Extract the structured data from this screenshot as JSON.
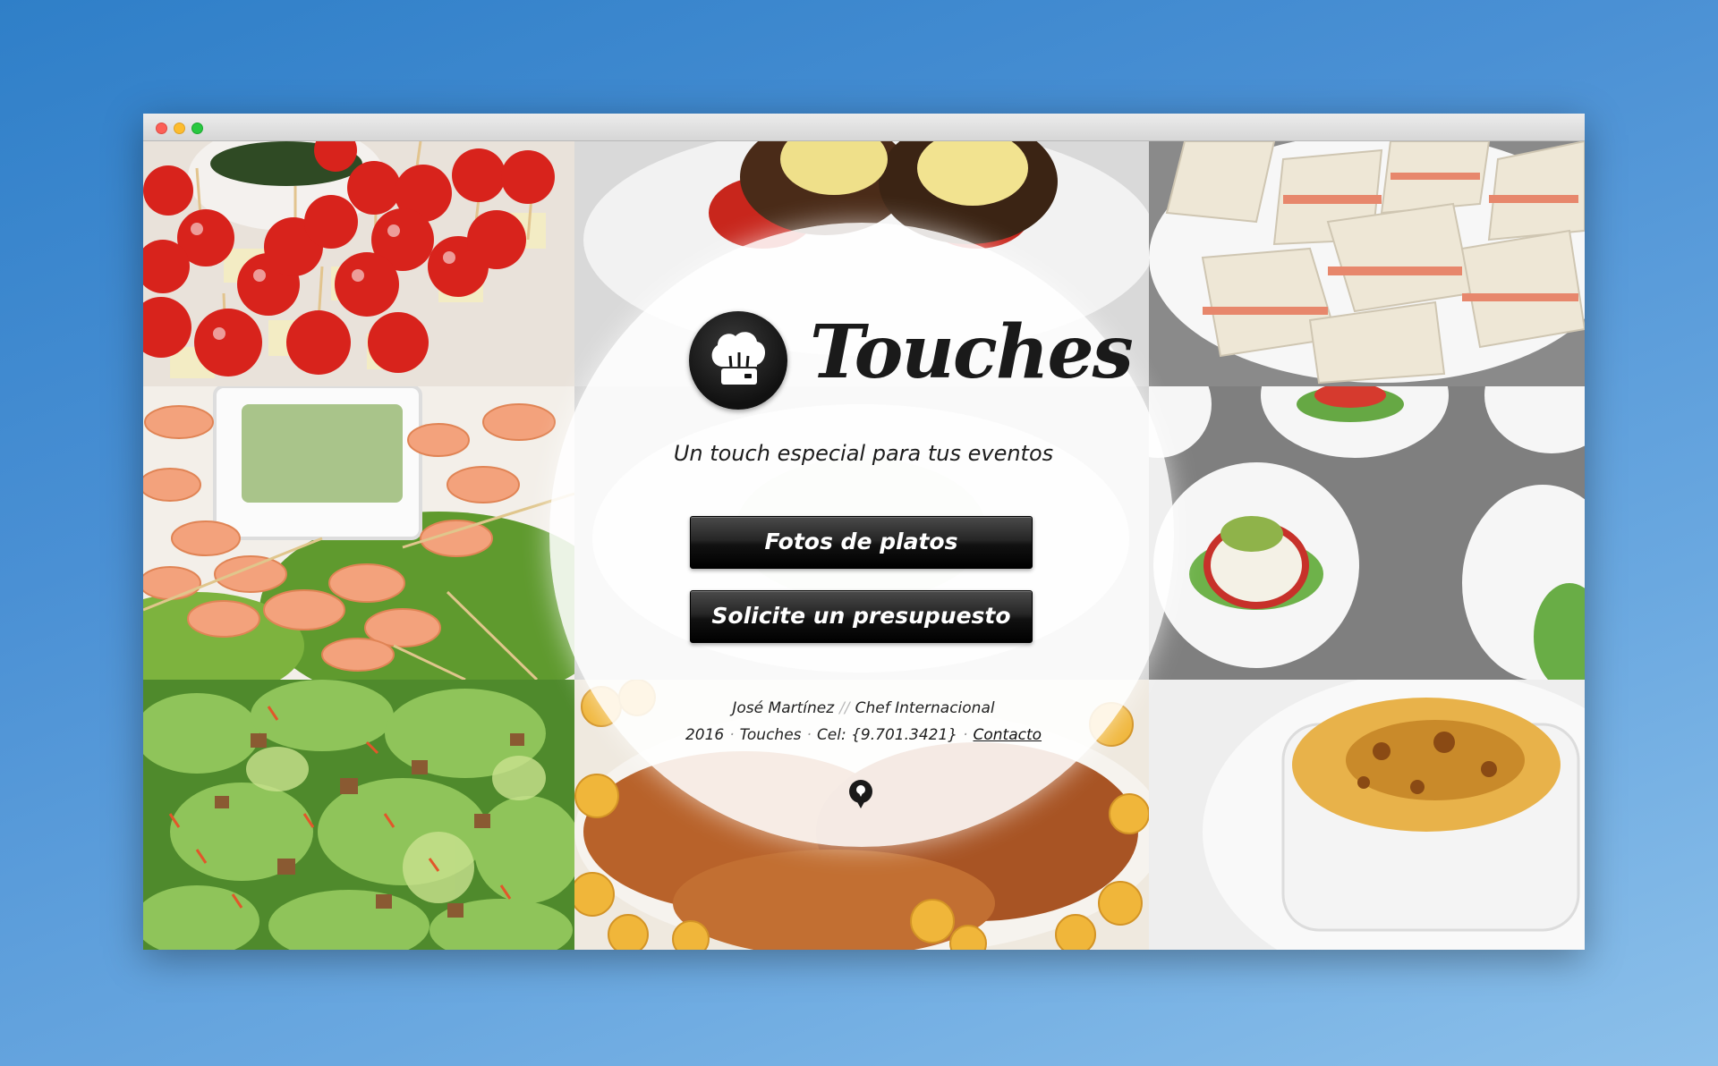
{
  "brand": {
    "name": "Touches",
    "tagline": "Un touch especial para tus eventos"
  },
  "buttons": {
    "photos_label": "Fotos de platos",
    "quote_label": "Solicite un presupuesto"
  },
  "credits": {
    "chef_name": "José Martínez",
    "separator": "//",
    "chef_title": "Chef Internacional",
    "year": "2016",
    "dot": "·",
    "company": "Touches",
    "phone": "Cel: {9.701.3421}",
    "contact_label": "Contacto"
  },
  "icons": {
    "logo": "chef-hat-icon",
    "map": "map-pin-icon"
  },
  "colors": {
    "background": "#4a90d4",
    "button": "#1a1a1a",
    "overlay": "#ffffff"
  }
}
